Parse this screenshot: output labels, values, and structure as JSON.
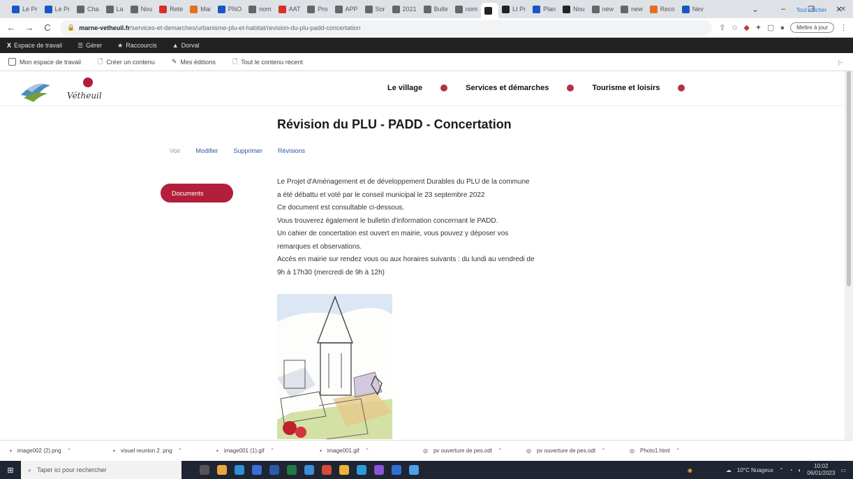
{
  "browser": {
    "tabs": [
      {
        "label": "Le Pr",
        "color": "#1a56c4"
      },
      {
        "label": "Le Pr",
        "color": "#1a56c4"
      },
      {
        "label": "Cha",
        "color": "#666666"
      },
      {
        "label": "La",
        "color": "#666666"
      },
      {
        "label": "Nou",
        "color": "#666666"
      },
      {
        "label": "Rete",
        "color": "#d93025"
      },
      {
        "label": "Mai",
        "color": "#e2711d"
      },
      {
        "label": "PNO",
        "color": "#1a56c4"
      },
      {
        "label": "nom",
        "color": "#666666"
      },
      {
        "label": "AAT",
        "color": "#d93025"
      },
      {
        "label": "Pro",
        "color": "#666666"
      },
      {
        "label": "APP",
        "color": "#666666"
      },
      {
        "label": "Sor",
        "color": "#666666"
      },
      {
        "label": "2021",
        "color": "#666666"
      },
      {
        "label": "Bulle",
        "color": "#666666"
      },
      {
        "label": "nom",
        "color": "#666666"
      },
      {
        "label": "",
        "color": "#222222"
      },
      {
        "label": "Lt Pr",
        "color": "#222222"
      },
      {
        "label": "Plan",
        "color": "#1a56c4"
      },
      {
        "label": "Nou",
        "color": "#222222"
      },
      {
        "label": "new",
        "color": "#666666"
      },
      {
        "label": "new",
        "color": "#666666"
      },
      {
        "label": "Reco",
        "color": "#e2711d"
      },
      {
        "label": "Nev",
        "color": "#1a56c4"
      }
    ],
    "url_domain": "marne-vetheuil.fr",
    "url_path": "/services-et-demarches/urbanisme-plu-et-habitat/revision-du-plu-padd-concertation",
    "update_label": "Mettre à jour"
  },
  "admin_toolbar": {
    "items": [
      "Espace de travail",
      "Gérer",
      "Raccourcis",
      "Dorval"
    ]
  },
  "shortcuts": {
    "items": [
      "Mon espace de travail",
      "Créer un contenu",
      "Mes éditions",
      "Tout le contenu récent"
    ]
  },
  "site": {
    "logo_text": "Vétheuil",
    "nav": [
      "Le village",
      "Services et démarches",
      "Tourisme et loisirs"
    ],
    "accent_color": "#b31f3a"
  },
  "page": {
    "title": "Révision du PLU - PADD - Concertation",
    "tabs": [
      "Voir",
      "Modifier",
      "Supprimer",
      "Révisions"
    ],
    "documents_button": "Documents",
    "body_lines": [
      "Le Projet d'Aménagement et de développement Durables du PLU de la commune",
      "a été débattu et voté par le conseil municipal le 23 septembre 2022",
      "Ce document est consultable ci-dessous.",
      "Vous trouverez également le bulletin d'information concernant le PADD.",
      "Un cahier de concertation est ouvert en mairie, vous pouvez y déposer vos",
      "remarques et observations.",
      "Accès en mairie sur rendez vous ou aux horaires suivants : du lundi au vendredi de",
      "9h à 17h30 (mercredi de 9h à 12h)"
    ]
  },
  "downloads": {
    "items": [
      "image002 (2).png",
      "visuel reunion 2 .png",
      "image001 (1).gif",
      "image001.gif",
      "pv ouverture de pes.odt",
      "pv ouverture de pes.odt",
      "Photo1.html"
    ],
    "show_all": "Tout afficher"
  },
  "taskbar": {
    "search_placeholder": "Taper ici pour rechercher",
    "weather": "10°C Nuageux",
    "time": "10:02",
    "date": "06/01/2023"
  }
}
